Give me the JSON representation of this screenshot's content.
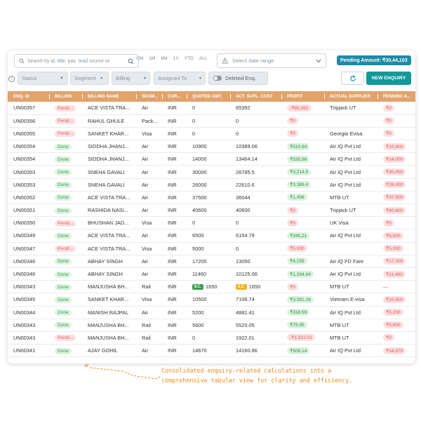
{
  "search": {
    "placeholder": "Search by id, title, pax, lead source or"
  },
  "ranges": [
    "CM",
    "1M",
    "6M",
    "1Y",
    "YTD",
    "ALL"
  ],
  "daterange": {
    "label": "Select date range"
  },
  "pending": {
    "label": "Pending Amount: ₹30,44,103"
  },
  "filters": [
    {
      "label": "Status"
    },
    {
      "label": "Segment"
    },
    {
      "label": "Billing"
    },
    {
      "label": "Assigned To"
    }
  ],
  "deleted": {
    "label": "Deleted Enq."
  },
  "new_enquiry": {
    "label": "NEW ENQUIRY"
  },
  "columns": [
    "ENQ. ID",
    "BILLING",
    "BILLING NAME",
    "SEGM...",
    "CUR...",
    "QUOTED AMT.",
    "ACT. SUPL. COST",
    "PROFIT",
    "ACTUAL SUPPLIER",
    "PENDING A..."
  ],
  "rows": [
    {
      "id": "UN00357",
      "billing": "Pendi...",
      "name": "ACE VISTA TRA...",
      "segment": "Air",
      "cur": "INR",
      "quoted": "0",
      "cost": "65392",
      "profit": "-₹65,392",
      "supplier": "Tripjack UT",
      "pending_amt": "₹0"
    },
    {
      "id": "UN00356",
      "billing": "Pendi...",
      "name": "RAHUL GHULE",
      "segment": "Pack...",
      "cur": "INR",
      "quoted": "0",
      "cost": "0",
      "profit": "₹0",
      "supplier": "",
      "pending_amt": "₹0"
    },
    {
      "id": "UN00355",
      "billing": "Pendi...",
      "name": "SANKET KHAR...",
      "segment": "Visa",
      "cur": "INR",
      "quoted": "0",
      "cost": "0",
      "profit": "₹0",
      "supplier": "Georgia Evisa",
      "pending_amt": "₹0"
    },
    {
      "id": "UN00354",
      "billing": "Done",
      "name": "SIDDHA JHANJ...",
      "segment": "Air",
      "cur": "INR",
      "quoted": "10900",
      "cost": "10389.06",
      "profit": "₹510.94",
      "supplier": "Air IQ Pvt Ltd",
      "pending_amt": "₹10,900"
    },
    {
      "id": "UN00354",
      "billing": "Done",
      "name": "SIDDHA JHANJ...",
      "segment": "Air",
      "cur": "INR",
      "quoted": "14000",
      "cost": "13464.14",
      "profit": "₹535.86",
      "supplier": "Air IQ Pvt Ltd",
      "pending_amt": "₹14,000"
    },
    {
      "id": "UN00353",
      "billing": "Done",
      "name": "SNEHA GAVALI",
      "segment": "Air",
      "cur": "INR",
      "quoted": "30000",
      "cost": "26785.5",
      "profit": "₹3,214.5",
      "supplier": "Air IQ Pvt Ltd",
      "pending_amt": "₹30,000"
    },
    {
      "id": "UN00353",
      "billing": "Done",
      "name": "SNEHA GAVALI",
      "segment": "Air",
      "cur": "INR",
      "quoted": "26000",
      "cost": "22610.6",
      "profit": "₹3,389.4",
      "supplier": "Air IQ Pvt Ltd",
      "pending_amt": "₹26,000"
    },
    {
      "id": "UN00352",
      "billing": "Done",
      "name": "ACE VISTA TRA...",
      "segment": "Air",
      "cur": "INR",
      "quoted": "37500",
      "cost": "36044",
      "profit": "₹1,456",
      "supplier": "MTB UT",
      "pending_amt": "₹37,500"
    },
    {
      "id": "UN00351",
      "billing": "Done",
      "name": "RASHIDA NASI...",
      "segment": "Air",
      "cur": "INR",
      "quoted": "40600",
      "cost": "40600",
      "profit": "₹0",
      "supplier": "Tripjack UT",
      "pending_amt": "₹40,600"
    },
    {
      "id": "UN00350",
      "billing": "Pendi...",
      "name": "BHUSHAN JAD...",
      "segment": "Visa",
      "cur": "INR",
      "quoted": "0",
      "cost": "0",
      "profit": "₹0",
      "supplier": "UK Visa",
      "pending_amt": "₹0"
    },
    {
      "id": "UN00349",
      "billing": "Done",
      "name": "ACE VISTA TRA...",
      "segment": "Air",
      "cur": "INR",
      "quoted": "6500",
      "cost": "6154.79",
      "profit": "₹345.21",
      "supplier": "Air IQ Pvt Ltd",
      "pending_amt": "₹6,500"
    },
    {
      "id": "UN00347",
      "billing": "Pendi...",
      "name": "ACE VISTA TRA...",
      "segment": "Visa",
      "cur": "INR",
      "quoted": "5000",
      "cost": "0",
      "profit": "₹5,000",
      "supplier": "",
      "pending_amt": "₹5,000"
    },
    {
      "id": "UN00346",
      "billing": "Done",
      "name": "ABHAY SINGH",
      "segment": "Air",
      "cur": "INR",
      "quoted": "17205",
      "cost": "13050",
      "profit": "₹4,155",
      "supplier": "Air IQ FD Fare",
      "pending_amt": "₹17,205"
    },
    {
      "id": "UN00346",
      "billing": "Done",
      "name": "ABHAY SINGH",
      "segment": "Air",
      "cur": "INR",
      "quoted": "11460",
      "cost": "10125.06",
      "profit": "₹1,334.94",
      "supplier": "Air IQ Pvt Ltd",
      "pending_amt": "₹11,460"
    },
    {
      "id": "UN00343",
      "billing": "Done",
      "name": "MANJUSHA BH...",
      "segment": "Rail",
      "cur": "INR",
      "quoted": "1650",
      "quoted_tag": "B.C.",
      "cost": "1650",
      "cost_tag": "S.C.",
      "profit": "₹0",
      "supplier": "MTB UT",
      "pending_amt": "—"
    },
    {
      "id": "UN00345",
      "billing": "Done",
      "name": "SANKET KHAR...",
      "segment": "Visa",
      "cur": "INR",
      "quoted": "10500",
      "cost": "7108.74",
      "profit": "₹3,391.26",
      "supplier": "Vietnam E-visa",
      "pending_amt": "₹10,500"
    },
    {
      "id": "UN00344",
      "billing": "Done",
      "name": "MANISH RAJPAL",
      "segment": "Air",
      "cur": "INR",
      "quoted": "5200",
      "cost": "4881.41",
      "profit": "₹318.59",
      "supplier": "Air IQ Pvt Ltd",
      "pending_amt": "₹5,200"
    },
    {
      "id": "UN00343",
      "billing": "Done",
      "name": "MANJUSHA BH...",
      "segment": "Rail",
      "cur": "INR",
      "quoted": "5600",
      "cost": "5520.05",
      "profit": "₹79.95",
      "supplier": "MTB UT",
      "pending_amt": "₹5,600"
    },
    {
      "id": "UN00343",
      "billing": "Pendi...",
      "name": "MANJUSHA BH...",
      "segment": "Rail",
      "cur": "INR",
      "quoted": "0",
      "cost": "1922.01",
      "profit": "-₹1,922.01",
      "supplier": "MTB UT",
      "pending_amt": "₹0"
    },
    {
      "id": "UN00341",
      "billing": "Done",
      "name": "AJAY GOHIL",
      "segment": "Air",
      "cur": "INR",
      "quoted": "14670",
      "cost": "14160.86",
      "profit": "₹509.14",
      "supplier": "Air IQ Pvt Ltd",
      "pending_amt": "₹14,670"
    }
  ],
  "note": {
    "line1": "Consolidated enquiry-related calculations into a",
    "line2": "comprehensive tabular view for clarity and efficiency."
  },
  "colors": {
    "header": "#e1a36c",
    "accent": "#12999a",
    "pending_badge": "#1e8aa6",
    "note": "#f08a1c"
  }
}
